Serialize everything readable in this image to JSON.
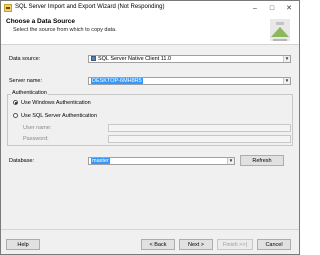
{
  "window": {
    "title": "SQL Server Import and Export Wizard (Not Responding)",
    "controls": {
      "minimize": "–",
      "maximize": "□",
      "close": "✕"
    }
  },
  "header": {
    "title": "Choose a Data Source",
    "subtitle": "Select the source from which to copy data."
  },
  "form": {
    "data_source_label": "Data source:",
    "data_source_value": "SQL Server Native Client 11.0",
    "server_name_label": "Server name:",
    "server_name_value": "DESKTOP-6MH8R5",
    "auth_group_label": "Authentication",
    "windows_auth_label": "Use Windows Authentication",
    "sql_auth_label": "Use SQL Server Authentication",
    "user_name_label": "User name:",
    "password_label": "Password:",
    "database_label": "Database:",
    "database_value": "master",
    "refresh_label": "Refresh"
  },
  "footer": {
    "help_label": "Help",
    "back_label": "< Back",
    "next_label": "Next >",
    "finish_label": "Finish >>|",
    "cancel_label": "Cancel"
  },
  "colors": {
    "selection": "#3399ff",
    "window_bg": "#f0f0f0"
  },
  "icons": {
    "app": "import-export-icon",
    "logo": "wizard-logo-icon",
    "data_source": "native-client-icon"
  }
}
